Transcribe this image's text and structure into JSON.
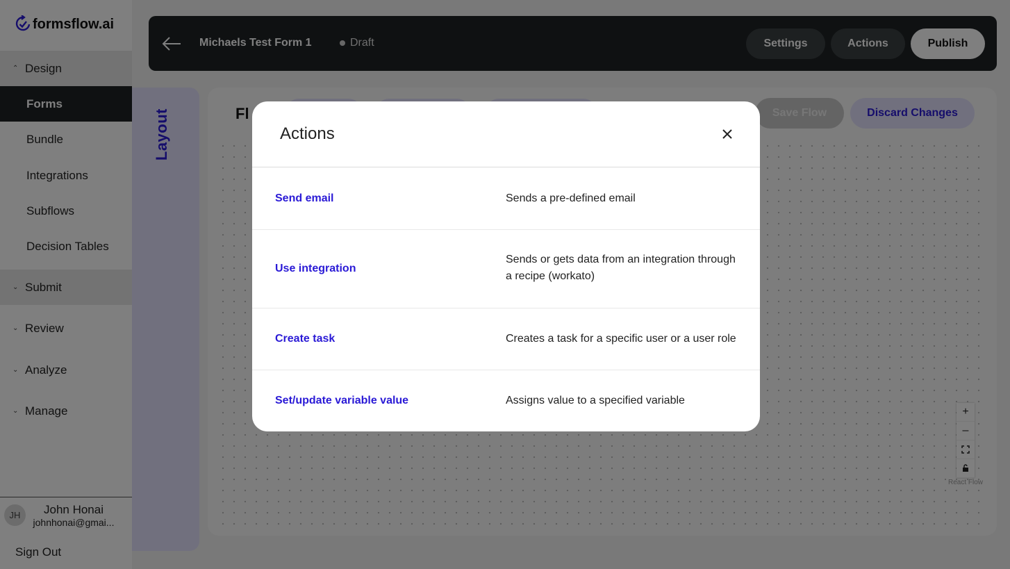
{
  "brand": {
    "name": "formsflow.ai",
    "accent": "#2a1ad6"
  },
  "sidebar": {
    "groups": [
      {
        "label": "Design",
        "expanded": true,
        "items": [
          "Forms",
          "Bundle",
          "Integrations",
          "Subflows",
          "Decision Tables"
        ],
        "active_item": "Forms"
      },
      {
        "label": "Submit",
        "expanded": false
      },
      {
        "label": "Review",
        "expanded": false
      },
      {
        "label": "Analyze",
        "expanded": false
      },
      {
        "label": "Manage",
        "expanded": false
      }
    ],
    "user": {
      "initials": "JH",
      "name": "John Honai",
      "email": "johnhonai@gmai..."
    },
    "sign_out": "Sign Out"
  },
  "topbar": {
    "form_title": "Michaels Test Form 1",
    "status": "Draft",
    "buttons": {
      "settings": "Settings",
      "actions": "Actions",
      "publish": "Publish"
    }
  },
  "layout_tab": {
    "label": "Layout"
  },
  "panel": {
    "title": "Fl",
    "save_flow": "Save Flow",
    "discard_changes": "Discard Changes",
    "react_flow_attribution": "React Flow"
  },
  "modal": {
    "title": "Actions",
    "actions": [
      {
        "name": "Send email",
        "description": "Sends a pre-defined email"
      },
      {
        "name": "Use integration",
        "description": "Sends or gets data from an integration through a recipe (workato)"
      },
      {
        "name": "Create task",
        "description": "Creates a task for a specific user or a user role"
      },
      {
        "name": "Set/update variable value",
        "description": "Assigns value to a specified variable"
      }
    ]
  }
}
